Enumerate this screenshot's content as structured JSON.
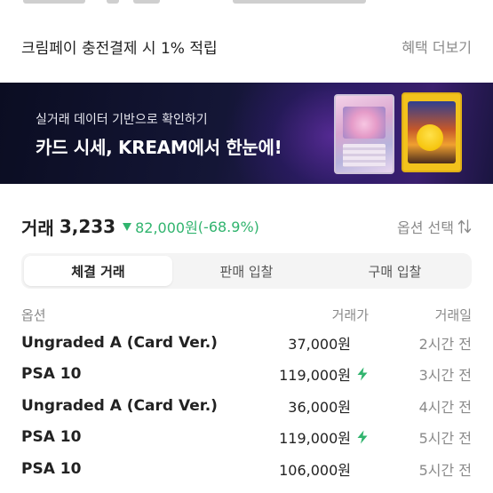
{
  "promo": {
    "text": "크림페이 충전결제 시 1% 적립",
    "link": "혜택 더보기"
  },
  "banner": {
    "subtitle": "실거래 데이터 기반으로 확인하기",
    "title": "카드 시세, KREAM에서 한눈에!"
  },
  "summary": {
    "label": "거래",
    "count": "3,233",
    "price": "82,000원",
    "change": "(-68.9%)",
    "trend": "down",
    "trend_color": "#31b46e",
    "option_label": "옵션 선택"
  },
  "tabs": [
    {
      "label": "체결 거래",
      "active": true
    },
    {
      "label": "판매 입찰",
      "active": false
    },
    {
      "label": "구매 입찰",
      "active": false
    }
  ],
  "table": {
    "headers": {
      "option": "옵션",
      "price": "거래가",
      "date": "거래일"
    },
    "rows": [
      {
        "option": "Ungraded A (Card Ver.)",
        "price": "37,000원",
        "fast": false,
        "date": "2시간 전"
      },
      {
        "option": "PSA 10",
        "price": "119,000원",
        "fast": true,
        "date": "3시간 전"
      },
      {
        "option": "Ungraded A (Card Ver.)",
        "price": "36,000원",
        "fast": false,
        "date": "4시간 전"
      },
      {
        "option": "PSA 10",
        "price": "119,000원",
        "fast": true,
        "date": "5시간 전"
      },
      {
        "option": "PSA 10",
        "price": "106,000원",
        "fast": false,
        "date": "5시간 전"
      }
    ]
  },
  "icons": {
    "fast_delivery": "lightning-icon",
    "sort": "sort-arrows-icon",
    "trend": "triangle-down-icon"
  },
  "colors": {
    "accent_green": "#31b46e",
    "muted": "#8a8a8a",
    "banner_bg": "#141636"
  }
}
